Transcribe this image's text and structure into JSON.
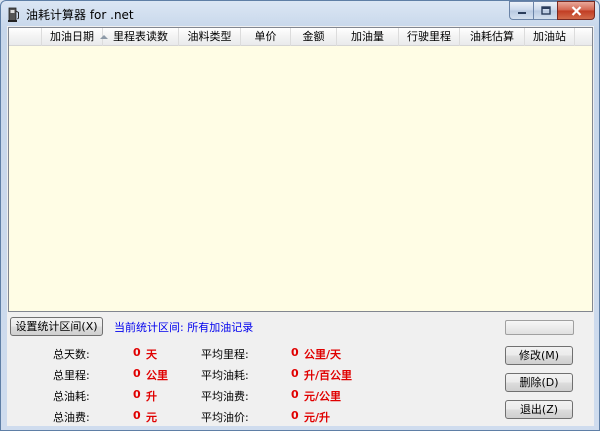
{
  "window": {
    "title": "油耗计算器 for .net",
    "icon": "fuel-pump-icon",
    "controls": [
      "minimize-icon",
      "maximize-icon",
      "close-icon"
    ]
  },
  "listview": {
    "columns": [
      "加油日期",
      "里程表读数",
      "油料类型",
      "单价",
      "金额",
      "加油量",
      "行驶里程",
      "油耗估算",
      "加油站"
    ],
    "sorted_column": "加油日期",
    "background": "#fffde5",
    "rows": []
  },
  "range": {
    "button_label": "设置统计区间(X)",
    "current": "当前统计区间: 所有加油记录"
  },
  "stats": {
    "total_days": {
      "label": "总天数:",
      "value": "0",
      "unit": "天"
    },
    "total_mileage": {
      "label": "总里程:",
      "value": "0",
      "unit": "公里"
    },
    "total_fuel": {
      "label": "总油耗:",
      "value": "0",
      "unit": "升"
    },
    "total_cost": {
      "label": "总油费:",
      "value": "0",
      "unit": "元"
    },
    "avg_mileage": {
      "label": "平均里程:",
      "value": "0",
      "unit": "公里/天"
    },
    "avg_consumption": {
      "label": "平均油耗:",
      "value": "0",
      "unit": "升/百公里"
    },
    "avg_cost": {
      "label": "平均油费:",
      "value": "0",
      "unit": "元/公里"
    },
    "avg_price": {
      "label": "平均油价:",
      "value": "0",
      "unit": "元/升"
    }
  },
  "actions": {
    "edit": "修改(M)",
    "delete": "删除(D)",
    "exit": "退出(Z)"
  },
  "colors": {
    "value_red": "#e00000",
    "link_blue": "#0000ee"
  }
}
